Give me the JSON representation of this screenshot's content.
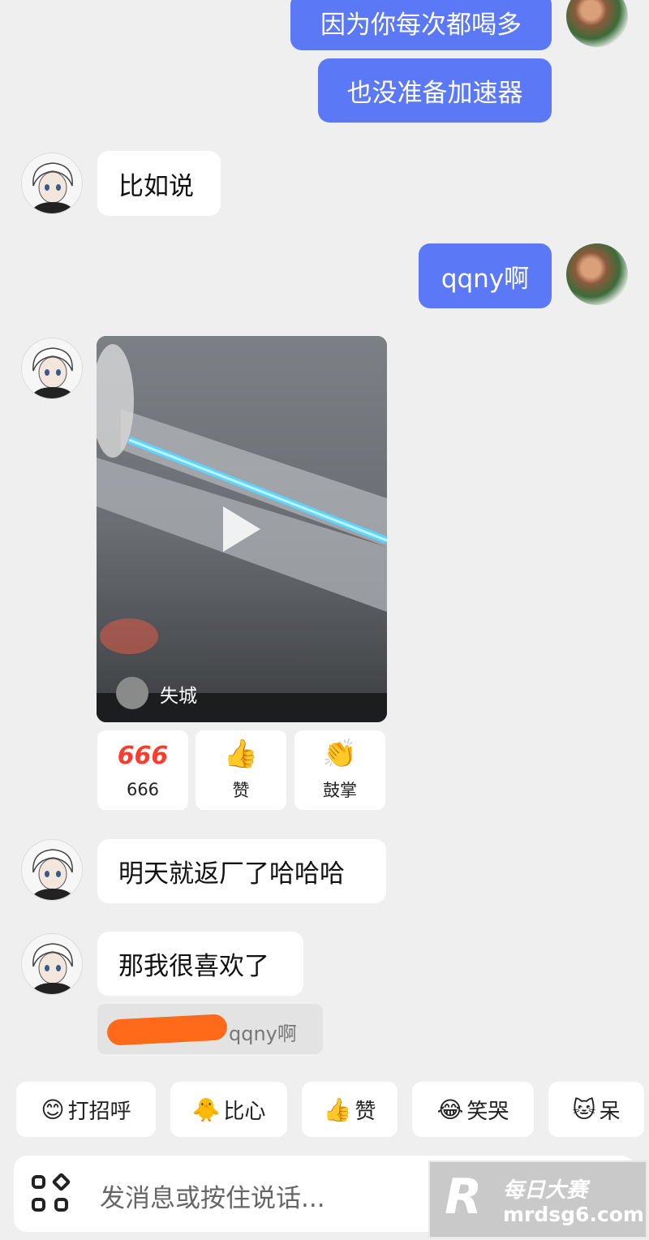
{
  "messages": {
    "m1": "因为你每次都喝多",
    "m2": "也没准备加速器",
    "m3": "比如说",
    "m4": "qqny啊",
    "m5": "明天就返厂了哈哈哈",
    "m6": "那我很喜欢了"
  },
  "video": {
    "author": "失城",
    "play_icon": "play-icon"
  },
  "reactions": [
    {
      "emoji": "666",
      "label": "666",
      "color": "#ff3b30"
    },
    {
      "emoji": "👍",
      "label": "赞"
    },
    {
      "emoji": "👏",
      "label": "鼓掌"
    }
  ],
  "reply_quote": {
    "text": "qqny啊",
    "redaction_color": "#ff6a1a"
  },
  "quick_replies": [
    {
      "emoji": "😊",
      "label": "打招呼"
    },
    {
      "emoji": "🐥",
      "label": "比心"
    },
    {
      "emoji": "👍",
      "label": "赞"
    },
    {
      "emoji": "😂",
      "label": "笑哭"
    },
    {
      "emoji": "🐱",
      "label": "呆"
    }
  ],
  "input": {
    "placeholder": "发消息或按住说话..."
  },
  "watermark": {
    "brand": "每日大赛",
    "site": "mrdsg6.com",
    "logo": "R"
  },
  "colors": {
    "my_bubble": "#5b78f6",
    "background": "#efefef"
  }
}
